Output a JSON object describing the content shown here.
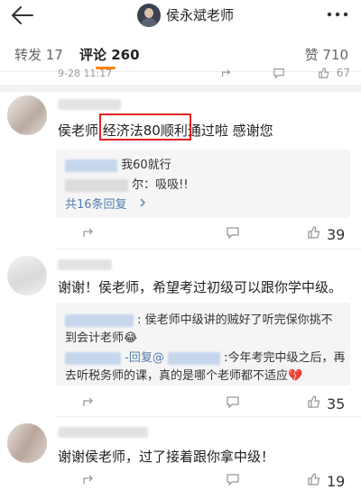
{
  "header": {
    "author": "侯永斌老师"
  },
  "tabs": {
    "repost": "转发 17",
    "comment": "评论 260",
    "like": "赞 710"
  },
  "prev": {
    "time": "9-28 11:17",
    "like_count": "67"
  },
  "comments": [
    {
      "text": "侯老师 经济法80顺利通过啦 感谢您",
      "replies": [
        {
          "text": "我60就行"
        },
        {
          "text": "尔：吸吸!!"
        }
      ],
      "more": "共16条回复",
      "like_count": "39"
    },
    {
      "text": "谢谢！侯老师，希望考过初级可以跟你学中级。",
      "replies": [
        {
          "line1": ": 侯老师中级讲的贼好了听完保你挑不",
          "line2": "到会计老师😂"
        },
        {
          "prefix": "-回复@",
          "line1": ":今年考完中级之后，再",
          "line2": "去听税务师的课，真的是哪个老师都不适应💔"
        }
      ],
      "like_count": "35"
    },
    {
      "text": "谢谢侯老师，过了接着跟你拿中级！",
      "like_count": "19"
    }
  ]
}
